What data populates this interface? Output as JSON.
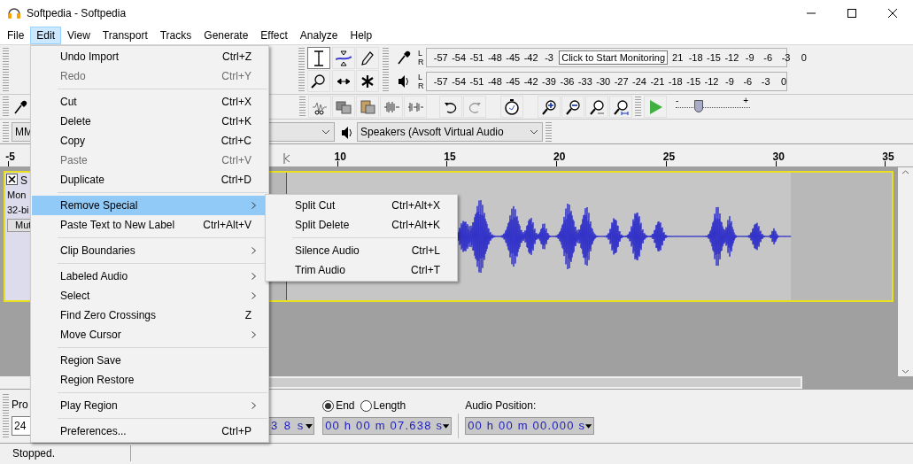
{
  "window": {
    "title": "Softpedia - Softpedia"
  },
  "menubar": [
    {
      "label": "File",
      "selected": false
    },
    {
      "label": "Edit",
      "selected": true
    },
    {
      "label": "View",
      "selected": false
    },
    {
      "label": "Transport",
      "selected": false
    },
    {
      "label": "Tracks",
      "selected": false
    },
    {
      "label": "Generate",
      "selected": false
    },
    {
      "label": "Effect",
      "selected": false
    },
    {
      "label": "Analyze",
      "selected": false
    },
    {
      "label": "Help",
      "selected": false
    }
  ],
  "tools": [
    {
      "kind": "ibeam",
      "selected": true
    },
    {
      "kind": "envelope",
      "selected": false
    },
    {
      "kind": "pencil",
      "selected": false
    },
    {
      "kind": "zoom",
      "selected": false
    },
    {
      "kind": "timeshift",
      "selected": false
    },
    {
      "kind": "multi",
      "selected": false
    }
  ],
  "meters": [
    {
      "kind": "record",
      "channels": [
        "L",
        "R"
      ],
      "ticks": [
        "-57",
        "-54",
        "-51",
        "-48",
        "-45",
        "-42",
        "-3"
      ],
      "tooltip": "Click to Start Monitoring",
      "ticks_after": [
        "21",
        "-18",
        "-15",
        "-12",
        "-9",
        "-6",
        "-3",
        "0"
      ]
    },
    {
      "kind": "playback",
      "channels": [
        "L",
        "R"
      ],
      "ticks": [
        "-57",
        "-54",
        "-51",
        "-48",
        "-45",
        "-42",
        "-39",
        "-36",
        "-33",
        "-30",
        "-27",
        "-24",
        "-21",
        "-18",
        "-15",
        "-12",
        "-9",
        "-6",
        "-3",
        "0"
      ]
    }
  ],
  "play_at_speed": {
    "level": 0.3,
    "min_label": "-",
    "max_label": "+"
  },
  "devices": {
    "host": "MM",
    "output": "Speakers (Avsoft Virtual Audio"
  },
  "ruler": {
    "ticks": [
      "-5",
      "10",
      "15",
      "20",
      "25",
      "30",
      "35"
    ]
  },
  "track": {
    "name": "S",
    "info": [
      "Mon",
      "32-bi"
    ],
    "mute": "Mut"
  },
  "selection_bar": {
    "rate_label": "Pro",
    "rate": "24",
    "start_time": "3 8 s",
    "end_options": [
      {
        "label": "End",
        "selected": true
      },
      {
        "label": "Length",
        "selected": false
      }
    ],
    "end_time": "00 h 00 m 07.638 s",
    "position_label": "Audio Position:",
    "position_time": "00 h 00 m 00.000 s"
  },
  "status_bar": {
    "text": "Stopped."
  },
  "edit_menu": [
    {
      "kind": "item",
      "label": "Undo Import",
      "shortcut": "Ctrl+Z",
      "disabled": false
    },
    {
      "kind": "item",
      "label": "Redo",
      "shortcut": "Ctrl+Y",
      "disabled": true
    },
    {
      "kind": "separator"
    },
    {
      "kind": "item",
      "label": "Cut",
      "shortcut": "Ctrl+X",
      "disabled": false
    },
    {
      "kind": "item",
      "label": "Delete",
      "shortcut": "Ctrl+K",
      "disabled": false
    },
    {
      "kind": "item",
      "label": "Copy",
      "shortcut": "Ctrl+C",
      "disabled": false
    },
    {
      "kind": "item",
      "label": "Paste",
      "shortcut": "Ctrl+V",
      "disabled": true
    },
    {
      "kind": "item",
      "label": "Duplicate",
      "shortcut": "Ctrl+D",
      "disabled": false
    },
    {
      "kind": "separator"
    },
    {
      "kind": "submenu",
      "label": "Remove Special",
      "selected": true
    },
    {
      "kind": "item",
      "label": "Paste Text to New Label",
      "shortcut": "Ctrl+Alt+V",
      "disabled": false
    },
    {
      "kind": "separator"
    },
    {
      "kind": "submenu",
      "label": "Clip Boundaries",
      "selected": false
    },
    {
      "kind": "separator"
    },
    {
      "kind": "submenu",
      "label": "Labeled Audio",
      "selected": false
    },
    {
      "kind": "submenu",
      "label": "Select",
      "selected": false
    },
    {
      "kind": "item",
      "label": "Find Zero Crossings",
      "shortcut": "Z",
      "disabled": false
    },
    {
      "kind": "submenu",
      "label": "Move Cursor",
      "selected": false
    },
    {
      "kind": "separator"
    },
    {
      "kind": "item",
      "label": "Region Save",
      "disabled": false
    },
    {
      "kind": "item",
      "label": "Region Restore",
      "disabled": false
    },
    {
      "kind": "separator"
    },
    {
      "kind": "submenu",
      "label": "Play Region",
      "selected": false
    },
    {
      "kind": "separator"
    },
    {
      "kind": "item",
      "label": "Preferences...",
      "shortcut": "Ctrl+P",
      "disabled": false
    }
  ],
  "submenu": [
    {
      "kind": "item",
      "label": "Split Cut",
      "shortcut": "Ctrl+Alt+X"
    },
    {
      "kind": "item",
      "label": "Split Delete",
      "shortcut": "Ctrl+Alt+K"
    },
    {
      "kind": "separator"
    },
    {
      "kind": "item",
      "label": "Silence Audio",
      "shortcut": "Ctrl+L"
    },
    {
      "kind": "item",
      "label": "Trim Audio",
      "shortcut": "Ctrl+T"
    }
  ]
}
